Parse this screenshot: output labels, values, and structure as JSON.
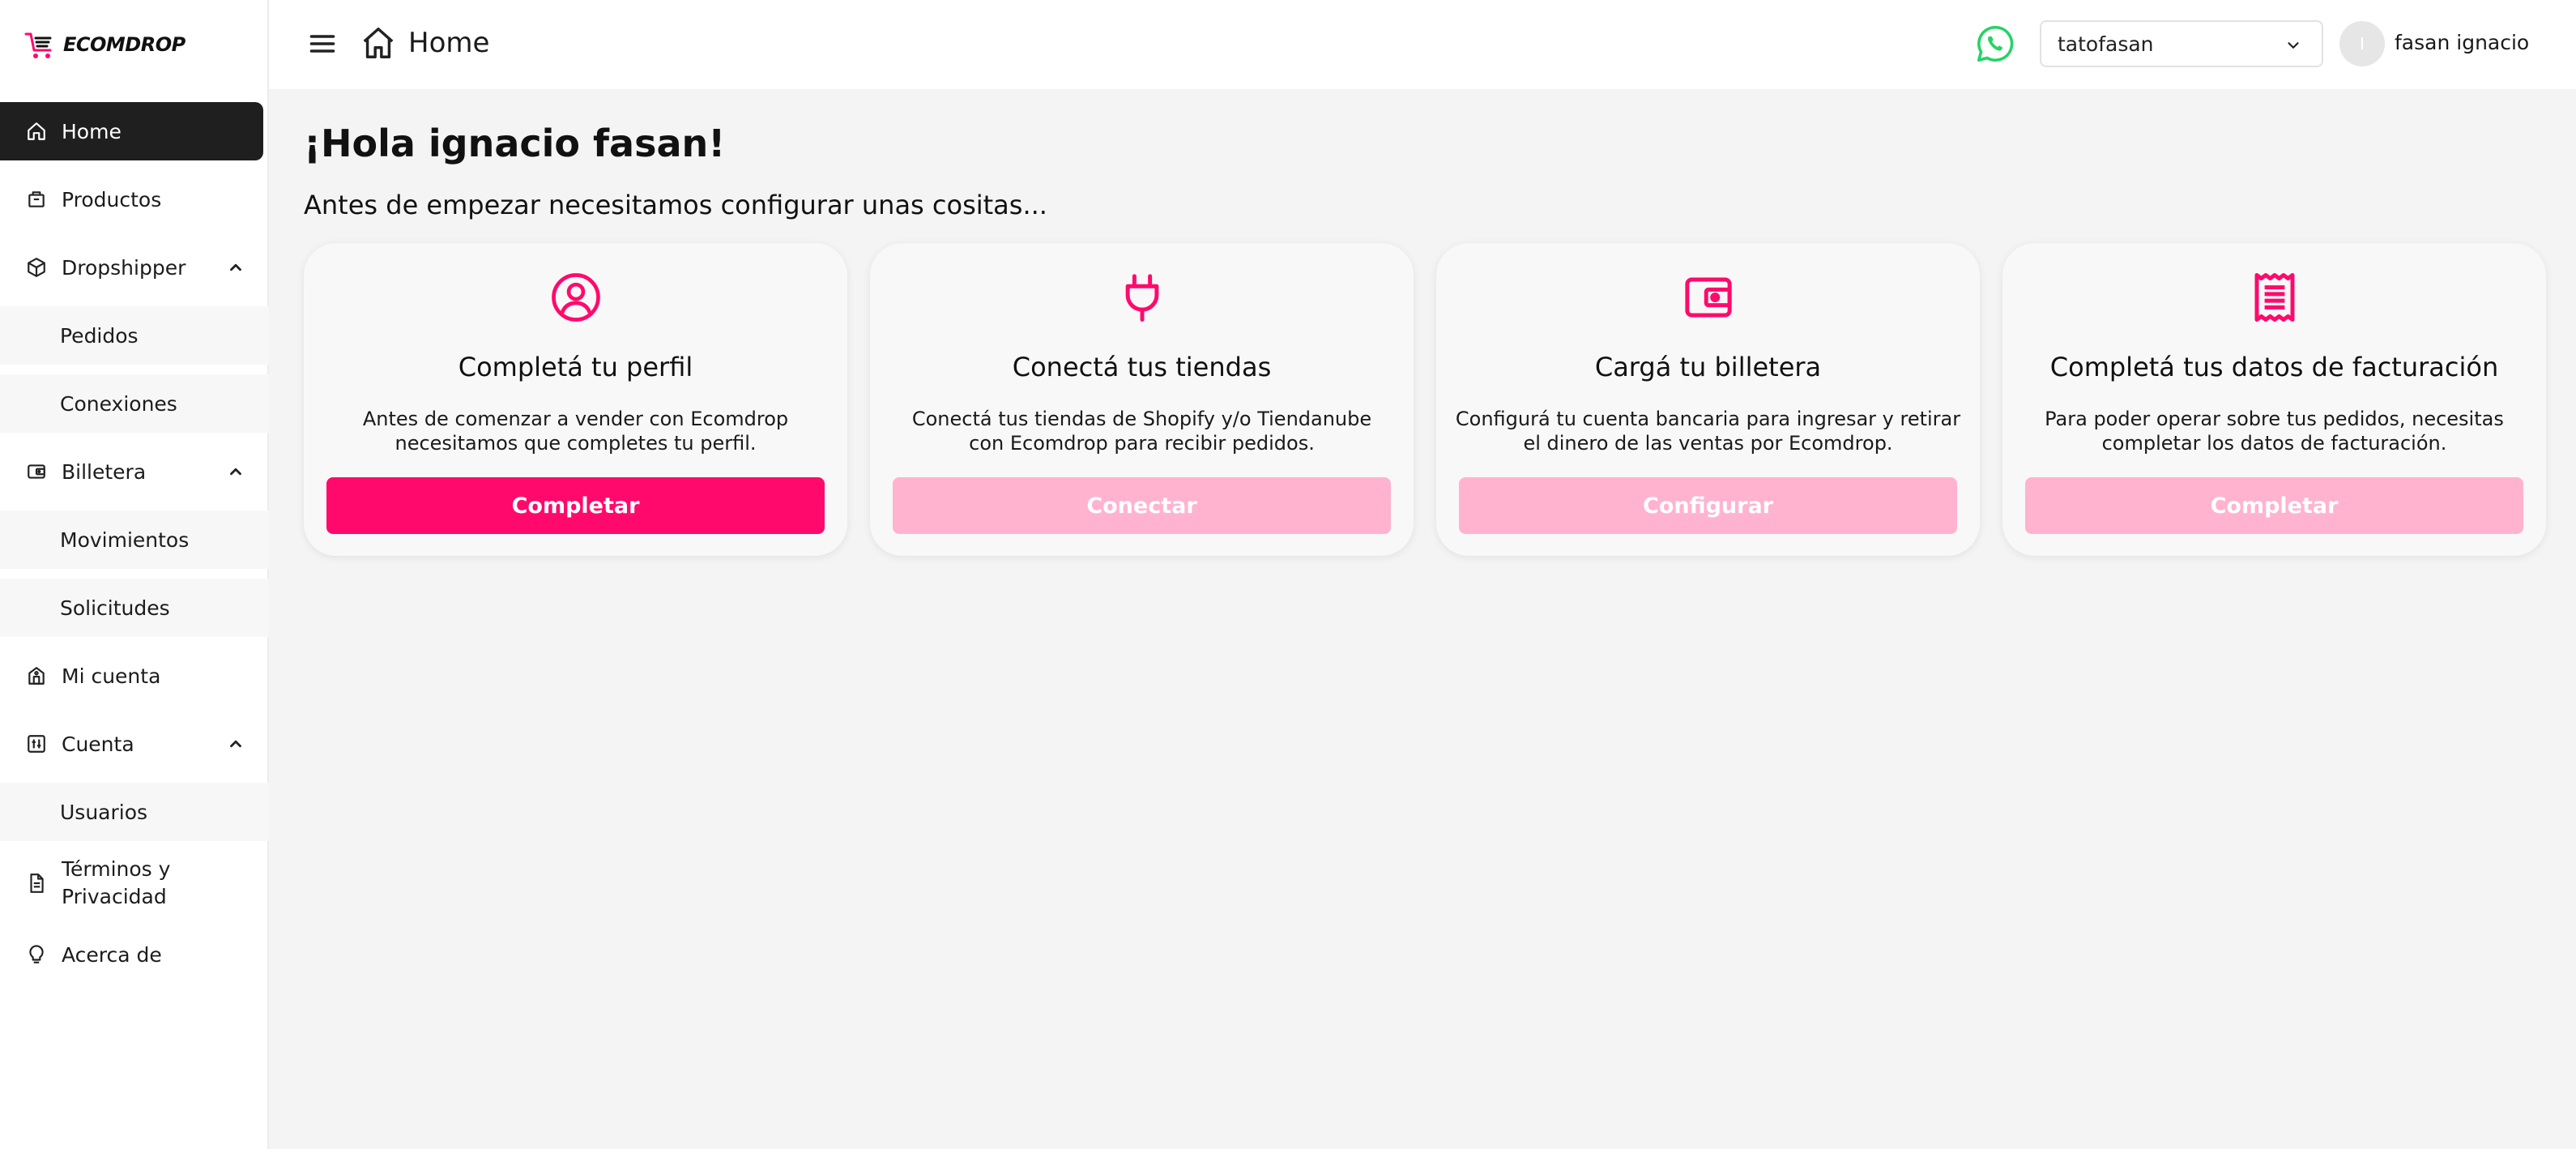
{
  "brand": {
    "name": "ECOMDROP",
    "accent": "#ff0a6c"
  },
  "sidebar": {
    "items": [
      {
        "label": "Home",
        "icon": "home-icon",
        "active": true
      },
      {
        "label": "Productos",
        "icon": "box-icon"
      },
      {
        "label": "Dropshipper",
        "icon": "package-icon",
        "expanded": true
      },
      {
        "label": "Pedidos",
        "sub": true
      },
      {
        "label": "Conexiones",
        "sub": true
      },
      {
        "label": "Billetera",
        "icon": "wallet-icon",
        "expanded": true
      },
      {
        "label": "Movimientos",
        "sub": true
      },
      {
        "label": "Solicitudes",
        "sub": true
      },
      {
        "label": "Mi cuenta",
        "icon": "building-icon"
      },
      {
        "label": "Cuenta",
        "icon": "sliders-icon",
        "expanded": true
      },
      {
        "label": "Usuarios",
        "sub": true
      },
      {
        "label": "Términos y Privacidad",
        "icon": "document-icon"
      },
      {
        "label": "Acerca de",
        "icon": "lightbulb-icon"
      }
    ]
  },
  "header": {
    "title": "Home",
    "store_select": {
      "value": "tatofasan"
    },
    "avatar_initial": "I",
    "user_name": "fasan ignacio",
    "whatsapp_color": "#25d366"
  },
  "main": {
    "greeting": "¡Hola ignacio fasan!",
    "subtitle": "Antes de empezar necesitamos configurar unas cositas...",
    "cards": [
      {
        "icon": "user-circle-icon",
        "title": "Completá tu perfil",
        "desc_line1": "Antes de comenzar a vender con Ecomdrop",
        "desc_line2": "necesitamos que completes tu perfil.",
        "button": "Completar",
        "enabled": true
      },
      {
        "icon": "plug-icon",
        "title": "Conectá tus tiendas",
        "desc_line1": "Conectá tus tiendas de Shopify y/o Tiendanube",
        "desc_line2": "con Ecomdrop para recibir pedidos.",
        "button": "Conectar",
        "enabled": false
      },
      {
        "icon": "wallet-icon",
        "title": "Cargá tu billetera",
        "desc_line1": "Configurá tu cuenta bancaria para ingresar y retirar",
        "desc_line2": "el dinero de las ventas por Ecomdrop.",
        "button": "Configurar",
        "enabled": false
      },
      {
        "icon": "receipt-icon",
        "title": "Completá tus datos de facturación",
        "desc_line1": "Para poder operar sobre tus pedidos, necesitas",
        "desc_line2": "completar los datos de facturación.",
        "button": "Completar",
        "enabled": false
      }
    ]
  }
}
